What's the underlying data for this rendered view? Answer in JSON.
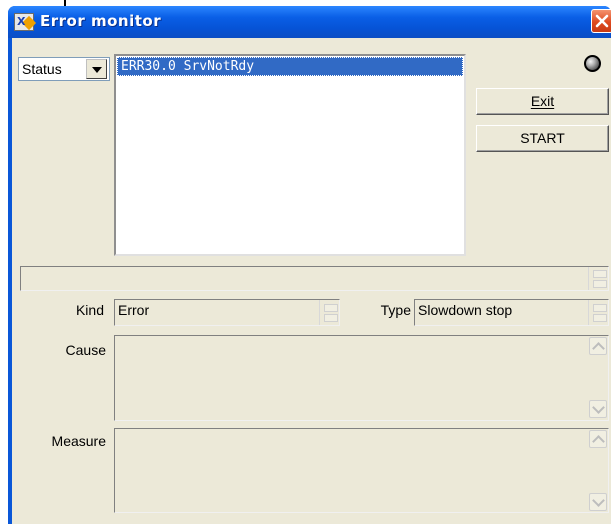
{
  "window": {
    "title": "Error monitor",
    "icon": "app-icon",
    "close_icon": "close-icon"
  },
  "status_select": {
    "value": "Status",
    "arrow_icon": "chevron-down-icon"
  },
  "error_list": {
    "items": [
      "ERR30.0 SrvNotRdy"
    ],
    "selected_index": 0
  },
  "status_lamp": {
    "icon": "status-lamp-icon",
    "color": "#808080"
  },
  "buttons": {
    "exit_label": "Exit",
    "start_label": "START"
  },
  "message_bar": {
    "value": ""
  },
  "kind": {
    "label": "Kind",
    "value": "Error"
  },
  "type": {
    "label": "Type",
    "value": "Slowdown stop"
  },
  "cause": {
    "label": "Cause",
    "value": ""
  },
  "measure": {
    "label": "Measure",
    "value": ""
  },
  "colors": {
    "titlebar": "#0a5fe6",
    "selection": "#316ac5",
    "dialog_bg": "#ece9d8"
  }
}
